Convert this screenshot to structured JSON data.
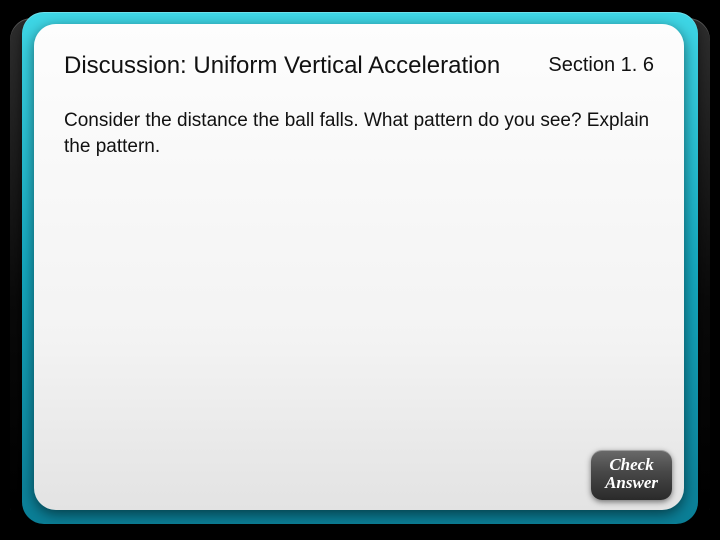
{
  "slide": {
    "title": "Discussion: Uniform Vertical Acceleration",
    "section": "Section 1. 6",
    "body": "Consider the distance the ball falls. What pattern do you see? Explain the pattern."
  },
  "button": {
    "line1": "Check",
    "line2": "Answer"
  }
}
